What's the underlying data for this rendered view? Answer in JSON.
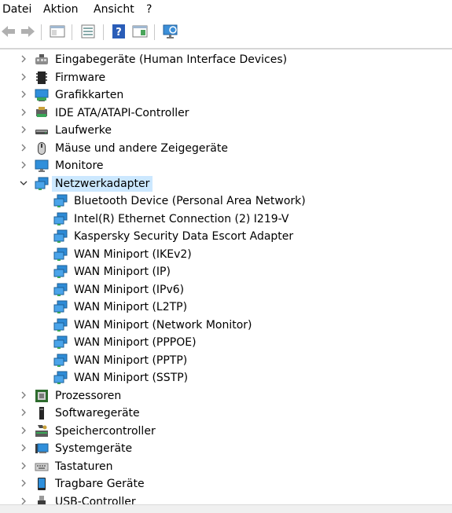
{
  "menu": {
    "file": "Datei",
    "action": "Aktion",
    "view": "Ansicht",
    "help": "?"
  },
  "toolbar": {
    "back": "back-arrow-icon",
    "forward": "forward-arrow-icon",
    "show_hide_console": "console-tree-icon",
    "properties": "properties-icon",
    "help": "help-icon",
    "action_pane": "action-pane-icon",
    "scan": "scan-hardware-icon"
  },
  "tree": {
    "categories": [
      {
        "label": "Eingabegeräte (Human Interface Devices)",
        "icon": "hid-icon"
      },
      {
        "label": "Firmware",
        "icon": "firmware-icon"
      },
      {
        "label": "Grafikkarten",
        "icon": "display-adapter-icon"
      },
      {
        "label": "IDE ATA/ATAPI-Controller",
        "icon": "ide-controller-icon"
      },
      {
        "label": "Laufwerke",
        "icon": "disk-drive-icon"
      },
      {
        "label": "Mäuse und andere Zeigegeräte",
        "icon": "mouse-icon"
      },
      {
        "label": "Monitore",
        "icon": "monitor-icon"
      },
      {
        "label": "Netzwerkadapter",
        "icon": "network-adapter-icon",
        "expanded": true,
        "selected": true
      },
      {
        "label": "Prozessoren",
        "icon": "processor-icon"
      },
      {
        "label": "Softwaregeräte",
        "icon": "software-device-icon"
      },
      {
        "label": "Speichercontroller",
        "icon": "storage-controller-icon"
      },
      {
        "label": "Systemgeräte",
        "icon": "system-device-icon"
      },
      {
        "label": "Tastaturen",
        "icon": "keyboard-icon"
      },
      {
        "label": "Tragbare Geräte",
        "icon": "portable-device-icon"
      },
      {
        "label": "USB-Controller",
        "icon": "usb-controller-icon"
      }
    ],
    "network_children": [
      "Bluetooth Device (Personal Area Network)",
      "Intel(R) Ethernet Connection (2) I219-V",
      "Kaspersky Security Data Escort Adapter",
      "WAN Miniport (IKEv2)",
      "WAN Miniport (IP)",
      "WAN Miniport (IPv6)",
      "WAN Miniport (L2TP)",
      "WAN Miniport (Network Monitor)",
      "WAN Miniport (PPPOE)",
      "WAN Miniport (PPTP)",
      "WAN Miniport (SSTP)"
    ]
  },
  "colors": {
    "selection": "#cce8ff",
    "network_icon": "#2e8bd6",
    "accent_green": "#3aa657"
  }
}
